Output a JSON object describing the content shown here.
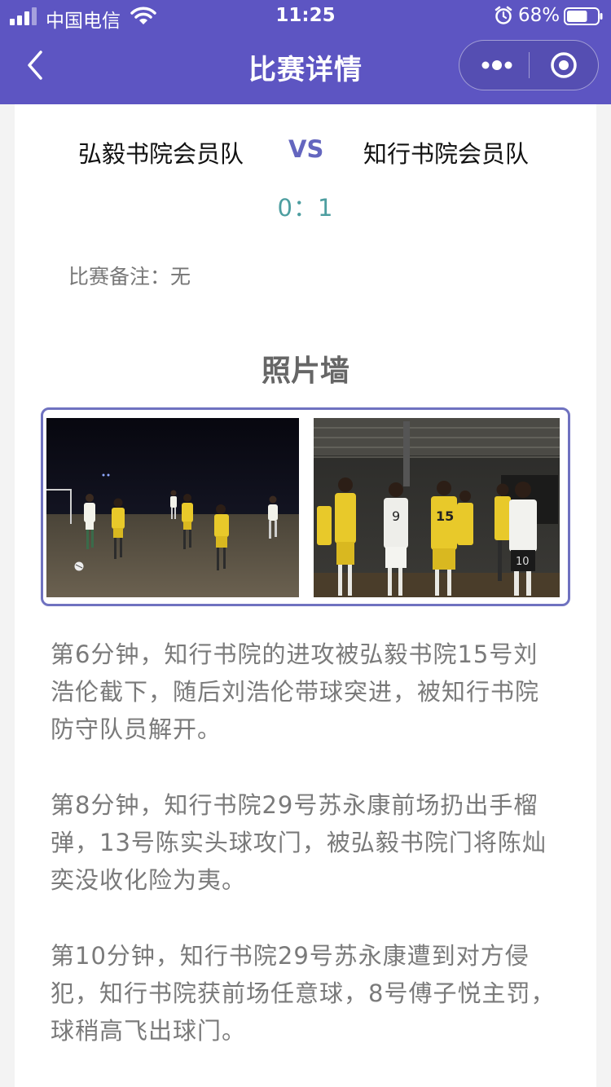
{
  "status_bar": {
    "carrier": "中国电信",
    "time": "11:25",
    "battery": "68%",
    "battery_level": 0.68
  },
  "nav": {
    "title": "比赛详情"
  },
  "match": {
    "home_team": "弘毅书院会员队",
    "vs": "VS",
    "away_team": "知行书院会员队",
    "score": "0：1",
    "remark": "比赛备注：无"
  },
  "photo_wall": {
    "title": "照片墙"
  },
  "commentary": [
    "第6分钟，知行书院的进攻被弘毅书院15号刘浩伦截下，随后刘浩伦带球突进，被知行书院防守队员解开。",
    "第8分钟，知行书院29号苏永康前场扔出手榴弹，13号陈实头球攻门，被弘毅书院门将陈灿奕没收化险为夷。",
    "第10分钟，知行书院29号苏永康遭到对方侵犯，知行书院获前场任意球，8号傅子悦主罚，球稍高飞出球门。"
  ],
  "colors": {
    "nav_bg": "#5d55c2",
    "vs": "#6466bf",
    "score": "#4d9ea0",
    "photo_border": "#6f72c0",
    "jersey_yellow": "#e8c92a"
  },
  "icons": {
    "back": "chevron-left-icon",
    "more": "more-dots-icon",
    "close": "target-close-icon",
    "wifi": "wifi-icon",
    "alarm": "alarm-icon",
    "battery": "battery-icon",
    "signal": "signal-icon"
  }
}
